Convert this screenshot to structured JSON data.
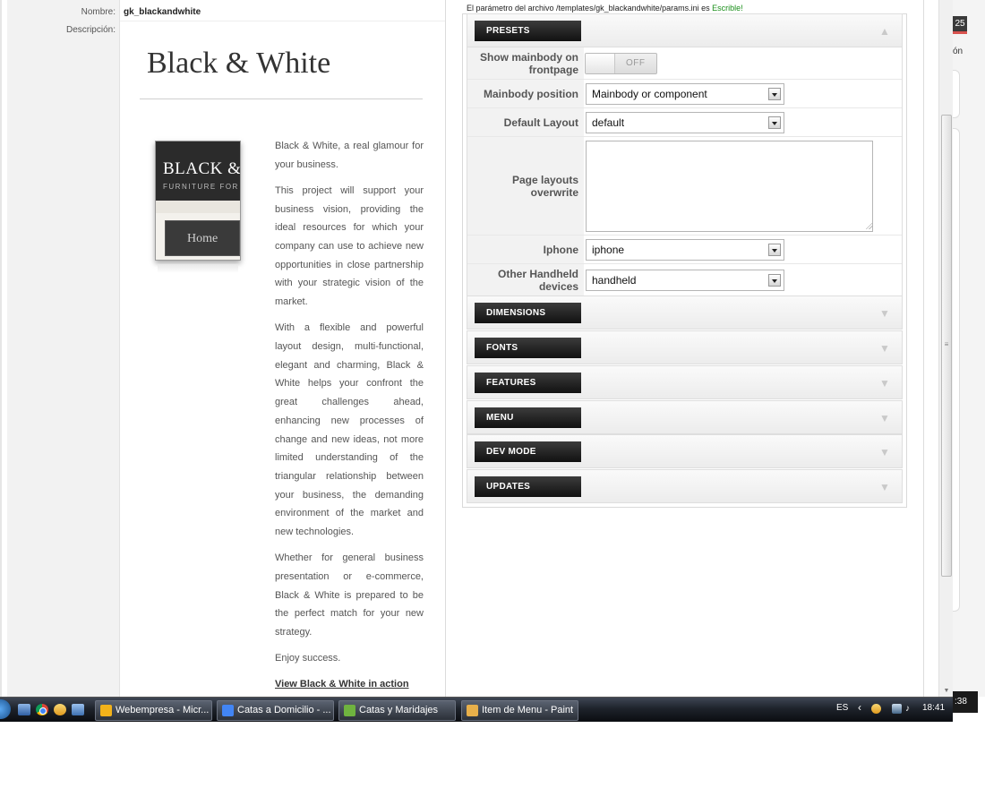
{
  "detail": {
    "name_label": "Nombre:",
    "name_value": "gk_blackandwhite",
    "desc_label": "Descripción:",
    "template_title": "Black & White",
    "thumbnail": {
      "brand": "BLACK &",
      "tagline": "FURNITURE FOR",
      "home_button": "Home"
    },
    "paragraphs": [
      "Black & White, a real glamour for your business.",
      "This project will support your business vision, providing the ideal resources for which your company can use to achieve new opportunities in close partnership with your strategic vision of the market.",
      "With a flexible and powerful layout design, multi-functional, elegant and charming, Black & White helps your confront the great challenges ahead, enhancing new processes of change and new ideas, not more limited understanding of the triangular relationship between your business, the demanding environment of the market and new technologies.",
      "Whether for general business presentation or e-commerce, Black & White is prepared to be the perfect match for your new strategy.",
      "Enjoy success.",
      "View Black & White in action"
    ]
  },
  "params": {
    "notice_text": "El parámetro del archivo /templates/gk_blackandwhite/params.ini es",
    "notice_status": "Escrible!",
    "presets": {
      "title": "PRESETS",
      "rows": {
        "show_mainbody": {
          "label": "Show mainbody on frontpage",
          "toggle": "OFF"
        },
        "mainbody_position": {
          "label": "Mainbody position",
          "value": "Mainbody or component"
        },
        "default_layout": {
          "label": "Default Layout",
          "value": "default"
        },
        "page_layouts": {
          "label": "Page layouts overwrite",
          "value": ""
        },
        "iphone": {
          "label": "Iphone",
          "value": "iphone"
        },
        "handheld": {
          "label": "Other Handheld devices",
          "value": "handheld"
        }
      }
    },
    "sections": [
      "DIMENSIONS",
      "FONTS",
      "FEATURES",
      "MENU",
      "DEV MODE",
      "UPDATES"
    ]
  },
  "browser_strip": {
    "badge": "25",
    "text": "ón"
  },
  "taskbar": {
    "tasks": [
      {
        "label": "Webempresa - Micr...",
        "icon_color": "#f2b21a"
      },
      {
        "label": "Catas a Domicilio - ...",
        "icon_color": "#4285f4"
      },
      {
        "label": "Catas y Maridajes",
        "icon_color": "#6fb33f"
      },
      {
        "label": "Item de Menu - Paint",
        "icon_color": "#e8b04a"
      }
    ],
    "lang": "ES",
    "time": "18:41",
    "edge_time": ":38"
  }
}
